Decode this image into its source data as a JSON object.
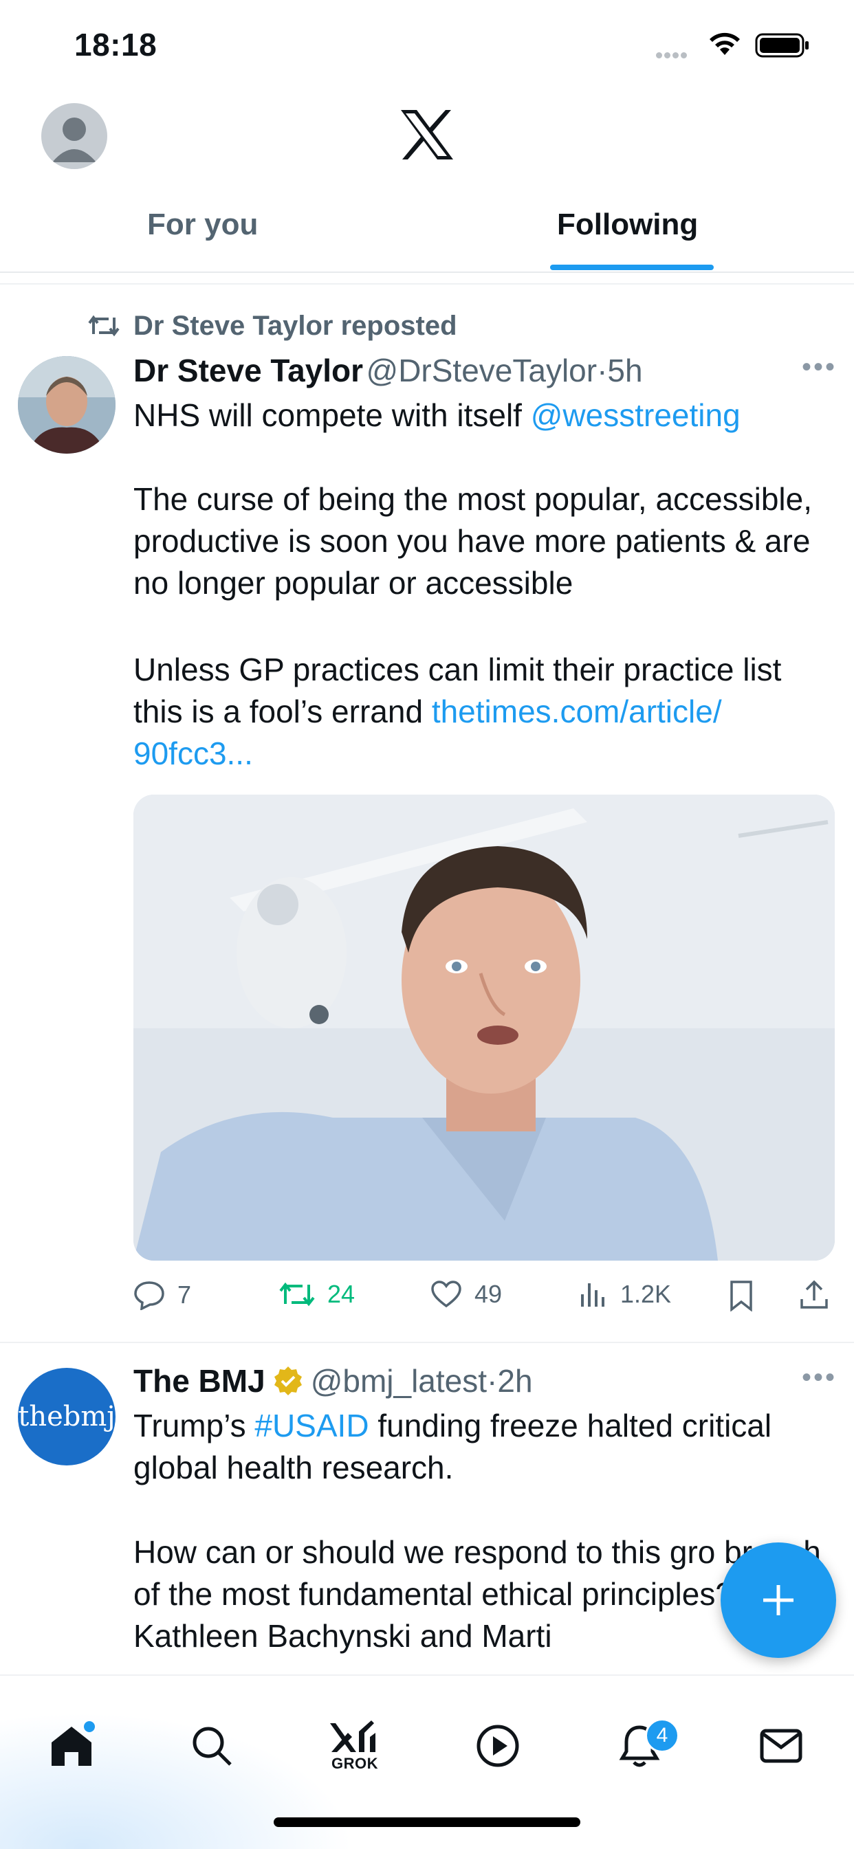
{
  "status_bar": {
    "time": "18:18"
  },
  "tabs": {
    "for_you": "For you",
    "following": "Following"
  },
  "colors": {
    "accent": "#1d9bf0",
    "repost_green": "#00ba7c",
    "secondary_text": "#536471"
  },
  "post1": {
    "repost_label": "Dr Steve Taylor reposted",
    "name": "Dr Steve Taylor",
    "handle": "@DrSteveTaylor",
    "separator": "·",
    "time": "5h",
    "line1": "NHS will compete with itself ",
    "mention": "@wesstreeting",
    "para2": "The curse of being the most popular, accessible, productive is soon you have more patients & are no longer popular or accessible",
    "para3": "Unless GP practices can limit their practice list this is a fool’s errand ",
    "link": "thetimes.com/article/ 90fcc3...",
    "actions": {
      "replies": "7",
      "reposts": "24",
      "likes": "49",
      "views": "1.2K"
    }
  },
  "post2": {
    "name": "The BMJ",
    "avatar_text": "thebmj",
    "handle": "@bmj_latest",
    "separator": "·",
    "time": "2h",
    "text_before": "Trump’s ",
    "hashtag": "#USAID",
    "text_after": " funding freeze halted critical global health research.",
    "para2": "How can or should we respond to this gro breach of the most fundamental ethical principles? Kathleen Bachynski and Marti"
  },
  "bottom_nav": {
    "grok_label": "GROK",
    "notifications_badge": "4",
    "items": [
      "home-icon",
      "search-icon",
      "grok-icon",
      "video-icon",
      "bell-icon",
      "mail-icon"
    ]
  }
}
